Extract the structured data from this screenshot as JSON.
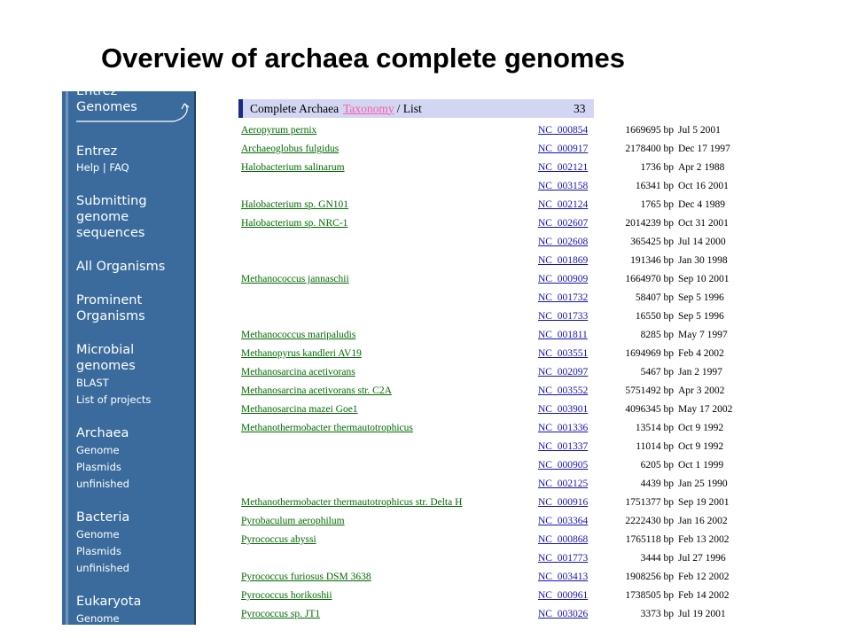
{
  "slide_title": "Overview of archaea complete genomes",
  "sidebar": {
    "top_logo_line1": "Entrez",
    "top_logo_line2": "Genomes",
    "entrez": "Entrez",
    "help_faq": "Help | FAQ",
    "submitting_1": "Submitting",
    "submitting_2": "genome",
    "submitting_3": "sequences",
    "all_organisms": "All Organisms",
    "prominent_1": "Prominent",
    "prominent_2": "Organisms",
    "microbial_1": "Microbial",
    "microbial_2": "genomes",
    "blast": "BLAST",
    "list_of_projects": "List of projects",
    "archaea": "Archaea",
    "archaea_genome": "Genome",
    "archaea_plasmids": "Plasmids",
    "archaea_unfinished": "unfinished",
    "bacteria": "Bacteria",
    "bacteria_genome": "Genome",
    "bacteria_plasmids": "Plasmids",
    "bacteria_unfinished": "unfinished",
    "eukaryota": "Eukaryota",
    "eukaryota_genome": "Genome"
  },
  "table": {
    "header_prefix": "Complete Archaea",
    "header_taxonomy": "Taxonomy",
    "header_suffix": "/ List",
    "count": "33",
    "rows": [
      {
        "organism": "Aeropyrum pernix",
        "accession": "NC_000854",
        "size": "1669695 bp",
        "date": "Jul 5 2001"
      },
      {
        "organism": "Archaeoglobus fulgidus",
        "accession": "NC_000917",
        "size": "2178400 bp",
        "date": "Dec 17 1997"
      },
      {
        "organism": "Halobacterium salinarum",
        "accession": "NC_002121",
        "size": "1736 bp",
        "date": "Apr 2 1988"
      },
      {
        "organism": "",
        "accession": "NC_003158",
        "size": "16341 bp",
        "date": "Oct 16 2001"
      },
      {
        "organism": "Halobacterium sp. GN101",
        "accession": "NC_002124",
        "size": "1765 bp",
        "date": "Dec 4 1989"
      },
      {
        "organism": "Halobacterium sp. NRC-1",
        "accession": "NC_002607",
        "size": "2014239 bp",
        "date": "Oct 31 2001"
      },
      {
        "organism": "",
        "accession": "NC_002608",
        "size": "365425 bp",
        "date": "Jul 14 2000"
      },
      {
        "organism": "",
        "accession": "NC_001869",
        "size": "191346 bp",
        "date": "Jan 30 1998"
      },
      {
        "organism": "Methanococcus jannaschii",
        "accession": "NC_000909",
        "size": "1664970 bp",
        "date": "Sep 10 2001"
      },
      {
        "organism": "",
        "accession": "NC_001732",
        "size": "58407 bp",
        "date": "Sep 5 1996"
      },
      {
        "organism": "",
        "accession": "NC_001733",
        "size": "16550 bp",
        "date": "Sep 5 1996"
      },
      {
        "organism": "Methanococcus maripaludis",
        "accession": "NC_001811",
        "size": "8285 bp",
        "date": "May 7 1997"
      },
      {
        "organism": "Methanopyrus kandleri AV19",
        "accession": "NC_003551",
        "size": "1694969 bp",
        "date": "Feb 4 2002"
      },
      {
        "organism": "Methanosarcina acetivorans",
        "accession": "NC_002097",
        "size": "5467 bp",
        "date": "Jan 2 1997"
      },
      {
        "organism": "Methanosarcina acetivorans str. C2A",
        "accession": "NC_003552",
        "size": "5751492 bp",
        "date": "Apr 3 2002"
      },
      {
        "organism": "Methanosarcina mazei Goe1",
        "accession": "NC_003901",
        "size": "4096345 bp",
        "date": "May 17 2002"
      },
      {
        "organism": "Methanothermobacter thermautotrophicus",
        "accession": "NC_001336",
        "size": "13514 bp",
        "date": "Oct 9 1992"
      },
      {
        "organism": "",
        "accession": "NC_001337",
        "size": "11014 bp",
        "date": "Oct 9 1992"
      },
      {
        "organism": "",
        "accession": "NC_000905",
        "size": "6205 bp",
        "date": "Oct 1 1999"
      },
      {
        "organism": "",
        "accession": "NC_002125",
        "size": "4439 bp",
        "date": "Jan 25 1990"
      },
      {
        "organism": "Methanothermobacter thermautotrophicus str. Delta H",
        "accession": "NC_000916",
        "size": "1751377 bp",
        "date": "Sep 19 2001"
      },
      {
        "organism": "Pyrobaculum aerophilum",
        "accession": "NC_003364",
        "size": "2222430 bp",
        "date": "Jan 16 2002"
      },
      {
        "organism": "Pyrococcus abyssi",
        "accession": "NC_000868",
        "size": "1765118 bp",
        "date": "Feb 13 2002"
      },
      {
        "organism": "",
        "accession": "NC_001773",
        "size": "3444 bp",
        "date": "Jul 27 1996"
      },
      {
        "organism": "Pyrococcus furiosus DSM 3638",
        "accession": "NC_003413",
        "size": "1908256 bp",
        "date": "Feb 12 2002"
      },
      {
        "organism": "Pyrococcus horikoshii",
        "accession": "NC_000961",
        "size": "1738505 bp",
        "date": "Feb 14 2002"
      },
      {
        "organism": "Pyrococcus sp. JT1",
        "accession": "NC_003026",
        "size": "3373 bp",
        "date": "Jul 19 2001"
      }
    ]
  },
  "colors": {
    "sidebar_bg": "#3a6b9c",
    "organism_link": "#006a00",
    "accession_link": "#1414b4",
    "header_bg": "#d2d6f2",
    "taxonomy_link": "#ff5aa8"
  }
}
